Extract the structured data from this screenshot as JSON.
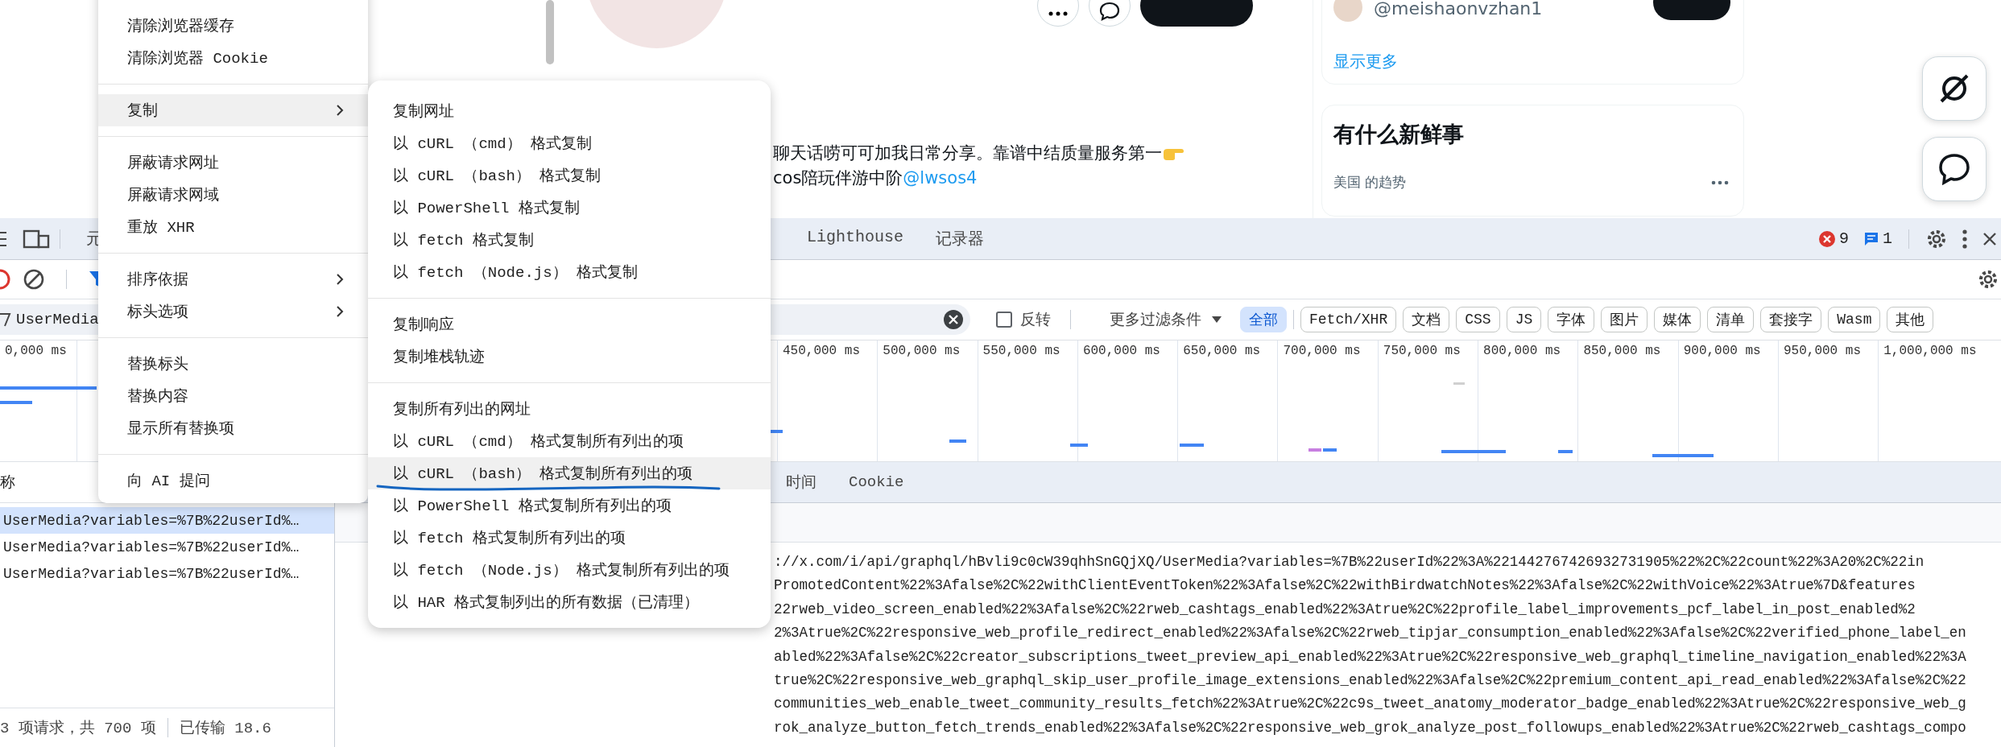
{
  "page": {
    "bio": {
      "line_1": "聊天话唠可可加我日常分享。靠谱中结质量服务第一",
      "line_2": "cos陪玩伴游中阶",
      "mention": "@lwsos4"
    },
    "who_to_follow": {
      "handle": "@meishaonvzhan1",
      "show_more": "显示更多"
    },
    "trends": {
      "title": "有什么新鲜事",
      "subtitle": "美国 的趋势"
    }
  },
  "devtools": {
    "tabs": [
      {
        "label": "元",
        "selected": false
      },
      {
        "label": "Lighthouse",
        "selected": false
      },
      {
        "label": "记录器",
        "selected": false
      }
    ],
    "errors": "9",
    "messages": "1",
    "filter": {
      "value": "UserMedia",
      "invert_label": "反转",
      "invert_checked": false,
      "more_filters": "更多过滤条件"
    },
    "type_filters": [
      {
        "label": "全部",
        "selected": true
      },
      {
        "label": "Fetch/XHR",
        "selected": false
      },
      {
        "label": "文档",
        "selected": false
      },
      {
        "label": "CSS",
        "selected": false
      },
      {
        "label": "JS",
        "selected": false
      },
      {
        "label": "字体",
        "selected": false
      },
      {
        "label": "图片",
        "selected": false
      },
      {
        "label": "媒体",
        "selected": false
      },
      {
        "label": "清单",
        "selected": false
      },
      {
        "label": "套接字",
        "selected": false
      },
      {
        "label": "Wasm",
        "selected": false
      },
      {
        "label": "其他",
        "selected": false
      }
    ],
    "timeline": {
      "ticks": [
        "0,000 ms",
        "450,000 ms",
        "500,000 ms",
        "550,000 ms",
        "600,000 ms",
        "650,000 ms",
        "700,000 ms",
        "750,000 ms",
        "800,000 ms",
        "850,000 ms",
        "900,000 ms",
        "950,000 ms",
        "1,000,000 ms"
      ]
    },
    "requests": {
      "column": "称",
      "rows": [
        {
          "name": "UserMedia?variables=%7B%22userId%…",
          "selected": true
        },
        {
          "name": "UserMedia?variables=%7B%22userId%…",
          "selected": false
        },
        {
          "name": "UserMedia?variables=%7B%22userId%…",
          "selected": false
        }
      ]
    },
    "detail_tabs": [
      {
        "label": "时间",
        "selected": false
      },
      {
        "label": "Cookie",
        "selected": false
      }
    ],
    "url_lines": [
      "://x.com/i/api/graphql/hBvli9c0cW39qhhSnGQjXQ/UserMedia?variables=%7B%22userId%22%3A%221442767426932731905%22%2C%22count%22%3A20%2C%22in",
      "PromotedContent%22%3Afalse%2C%22withClientEventToken%22%3Afalse%2C%22withBirdwatchNotes%22%3Afalse%2C%22withVoice%22%3Atrue%7D&features",
      "22rweb_video_screen_enabled%22%3Afalse%2C%22rweb_cashtags_enabled%22%3Atrue%2C%22profile_label_improvements_pcf_label_in_post_enabled%2",
      "2%3Atrue%2C%22responsive_web_profile_redirect_enabled%22%3Afalse%2C%22rweb_tipjar_consumption_enabled%22%3Afalse%2C%22verified_phone_label_en",
      "abled%22%3Afalse%2C%22creator_subscriptions_tweet_preview_api_enabled%22%3Atrue%2C%22responsive_web_graphql_timeline_navigation_enabled%22%3A",
      "true%2C%22responsive_web_graphql_skip_user_profile_image_extensions_enabled%22%3Afalse%2C%22premium_content_api_read_enabled%22%3Afalse%2C%22",
      "communities_web_enable_tweet_community_results_fetch%22%3Atrue%2C%22c9s_tweet_anatomy_moderator_badge_enabled%22%3Atrue%2C%22responsive_web_g",
      "rok_analyze_button_fetch_trends_enabled%22%3Afalse%2C%22responsive_web_grok_analyze_post_followups_enabled%22%3Atrue%2C%22rweb_cashtags_compo"
    ],
    "status": {
      "requests": "3 项请求，共 700 项",
      "transferred": "已传输 18.6"
    }
  },
  "context_menu": {
    "groups": [
      {
        "items": [
          {
            "label": "清除浏览器缓存",
            "submenu": false,
            "selected": false
          },
          {
            "label": "清除浏览器 Cookie",
            "submenu": false,
            "selected": false
          }
        ]
      },
      {
        "items": [
          {
            "label": "复制",
            "submenu": true,
            "selected": true
          }
        ]
      },
      {
        "items": [
          {
            "label": "屏蔽请求网址",
            "submenu": false,
            "selected": false
          },
          {
            "label": "屏蔽请求网域",
            "submenu": false,
            "selected": false
          },
          {
            "label": "重放 XHR",
            "submenu": false,
            "selected": false
          }
        ]
      },
      {
        "items": [
          {
            "label": "排序依据",
            "submenu": true,
            "selected": false
          },
          {
            "label": "标头选项",
            "submenu": true,
            "selected": false
          }
        ]
      },
      {
        "items": [
          {
            "label": "替换标头",
            "submenu": false,
            "selected": false
          },
          {
            "label": "替换内容",
            "submenu": false,
            "selected": false
          },
          {
            "label": "显示所有替换项",
            "submenu": false,
            "selected": false
          }
        ]
      },
      {
        "items": [
          {
            "label": "向 AI 提问",
            "submenu": false,
            "selected": false
          }
        ]
      }
    ]
  },
  "submenu": {
    "groups": [
      {
        "items": [
          {
            "label": "复制网址",
            "selected": false
          },
          {
            "label": "以 cURL （cmd） 格式复制",
            "selected": false
          },
          {
            "label": "以 cURL （bash） 格式复制",
            "selected": false
          },
          {
            "label": "以 PowerShell 格式复制",
            "selected": false
          },
          {
            "label": "以 fetch 格式复制",
            "selected": false
          },
          {
            "label": "以 fetch （Node.js） 格式复制",
            "selected": false
          }
        ]
      },
      {
        "items": [
          {
            "label": "复制响应",
            "selected": false
          },
          {
            "label": "复制堆栈轨迹",
            "selected": false
          }
        ]
      },
      {
        "items": [
          {
            "label": "复制所有列出的网址",
            "selected": false
          },
          {
            "label": "以 cURL （cmd） 格式复制所有列出的项",
            "selected": false
          },
          {
            "label": "以 cURL （bash） 格式复制所有列出的项",
            "selected": true
          },
          {
            "label": "以 PowerShell 格式复制所有列出的项",
            "selected": false
          },
          {
            "label": "以 fetch 格式复制所有列出的项",
            "selected": false
          },
          {
            "label": "以 fetch （Node.js） 格式复制所有列出的项",
            "selected": false
          },
          {
            "label": "以 HAR 格式复制列出的所有数据（已清理）",
            "selected": false
          }
        ]
      }
    ]
  }
}
